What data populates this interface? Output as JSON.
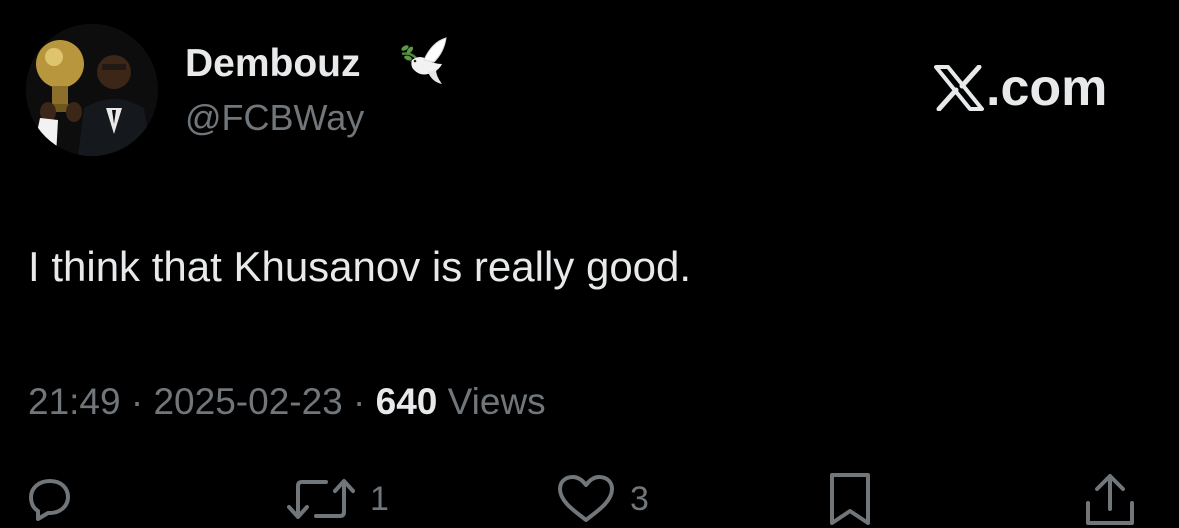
{
  "author": {
    "display_name": "Dembouz",
    "handle": "@FCBWay",
    "badge_icon": "dove-icon"
  },
  "brand": {
    "text": ".com",
    "icon": "x-logo-icon"
  },
  "tweet": {
    "text": "I think that Khusanov is really good.",
    "time": "21:49",
    "separator": " · ",
    "date": "2025-02-23",
    "views_count": "640",
    "views_label": " Views"
  },
  "actions": {
    "reply": {
      "icon": "reply-icon"
    },
    "retweet": {
      "icon": "retweet-icon",
      "count": "1"
    },
    "like": {
      "icon": "heart-icon",
      "count": "3"
    },
    "bookmark": {
      "icon": "bookmark-icon"
    },
    "share": {
      "icon": "share-icon"
    }
  },
  "colors": {
    "background": "#000000",
    "primary_text": "#e7e9ea",
    "secondary_text": "#71767b"
  }
}
